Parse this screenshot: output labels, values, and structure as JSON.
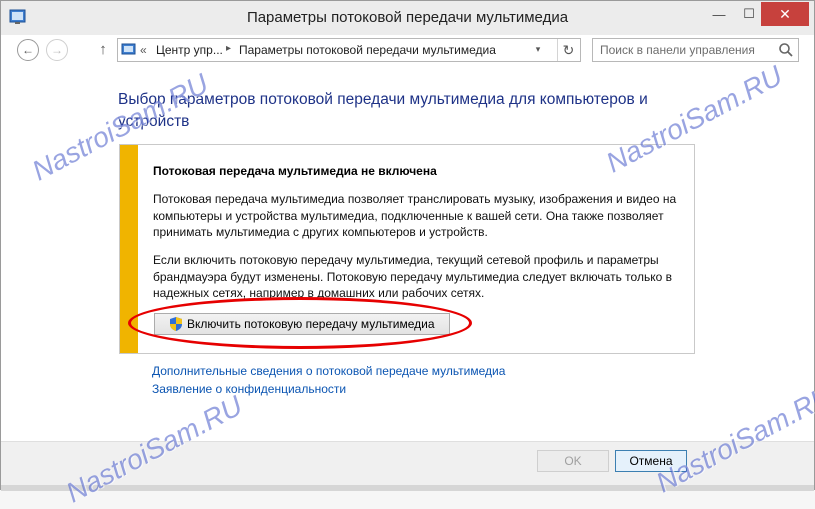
{
  "window": {
    "title": "Параметры потоковой передачи мультимедиа",
    "buttons": {
      "minimize": "—",
      "maximize": "☐",
      "close": "✕"
    }
  },
  "nav": {
    "back": "←",
    "forward": "→",
    "up": "↑",
    "breadcrumb_prefix": "«",
    "breadcrumb": [
      "Центр упр...",
      "Параметры потоковой передачи мультимедиа"
    ],
    "breadcrumb_sep": "▸",
    "dropdown": "▾",
    "refresh": "↻",
    "search_placeholder": "Поиск в панели управления"
  },
  "main": {
    "heading": "Выбор параметров потоковой передачи мультимедиа для компьютеров и устройств",
    "panel": {
      "title": "Потоковая передача мультимедиа не включена",
      "paragraph1": "Потоковая передача мультимедиа позволяет транслировать музыку, изображения и видео на компьютеры и устройства мультимедиа, подключенные к вашей сети. Она также позволяет принимать мультимедиа с других компьютеров и устройств.",
      "paragraph2": "Если включить потоковую передачу мультимедиа, текущий сетевой профиль и параметры брандмауэра будут изменены. Потоковую передачу мультимедиа следует включать только в надежных сетях, например в домашних или рабочих сетях.",
      "enable_button": "Включить потоковую передачу мультимедиа"
    },
    "links": [
      "Дополнительные сведения о потоковой передаче мультимедиа",
      "Заявление о конфиденциальности"
    ]
  },
  "footer": {
    "ok": "OK",
    "cancel": "Отмена"
  },
  "watermark": "NastroiSam.RU",
  "colors": {
    "accent_bar": "#f0b400",
    "heading": "#1e3287",
    "link": "#0b55b2",
    "highlight": "#e60000"
  }
}
